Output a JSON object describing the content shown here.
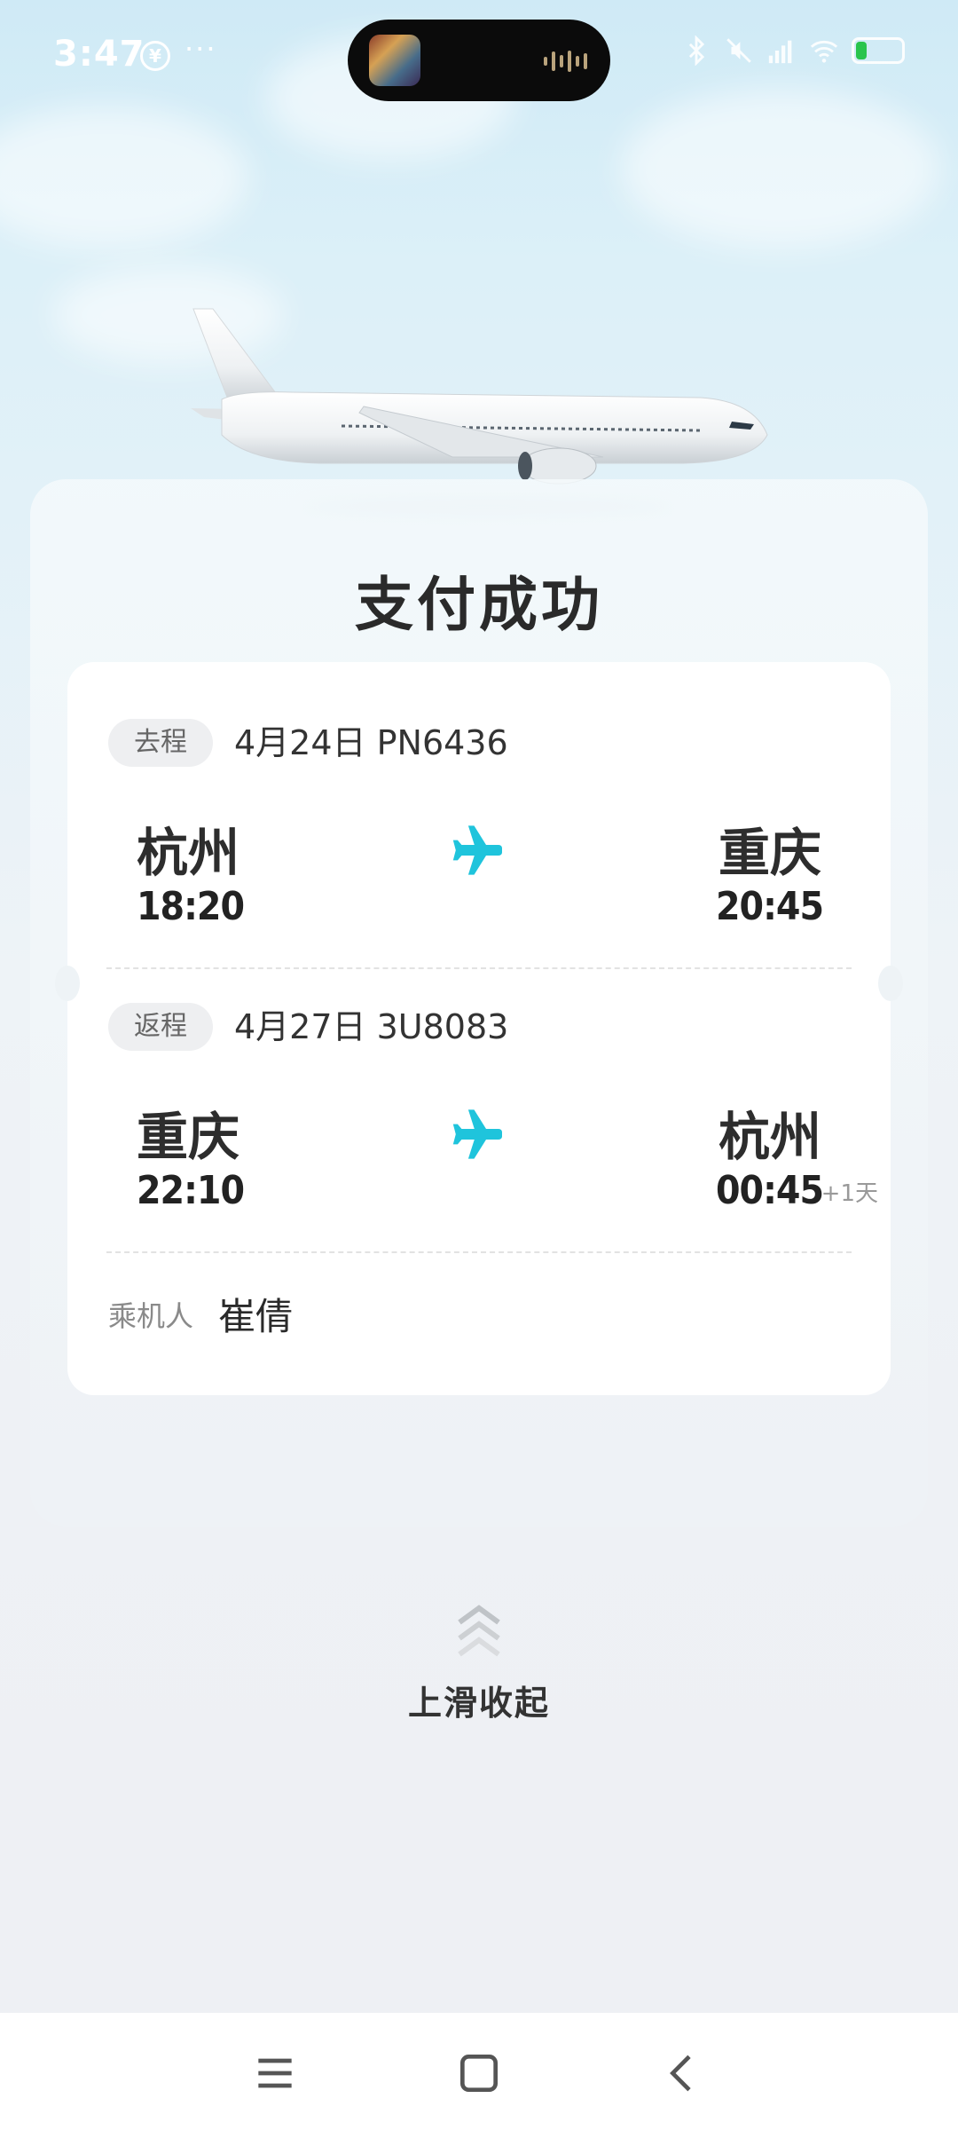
{
  "status_bar": {
    "time": "3:47",
    "app_icon_text": "¥",
    "more": "···",
    "icons": [
      "bluetooth-icon",
      "mute-icon",
      "signal-icon",
      "wifi-icon",
      "battery-icon"
    ]
  },
  "page": {
    "title": "支付成功",
    "swipe_hint": "上滑收起"
  },
  "trips": [
    {
      "tag": "去程",
      "date_flight": "4月24日  PN6436",
      "from_city": "杭州",
      "to_city": "重庆",
      "depart_time": "18:20",
      "arrive_time": "20:45",
      "next_day": ""
    },
    {
      "tag": "返程",
      "date_flight": "4月27日  3U8083",
      "from_city": "重庆",
      "to_city": "杭州",
      "depart_time": "22:10",
      "arrive_time": "00:45",
      "next_day": "+1天"
    }
  ],
  "passenger": {
    "label": "乘机人",
    "name": "崔倩"
  },
  "colors": {
    "accent_plane": "#1fc4dc",
    "battery_green": "#29c44d"
  },
  "nav": [
    "menu-icon",
    "home-icon",
    "back-icon"
  ]
}
